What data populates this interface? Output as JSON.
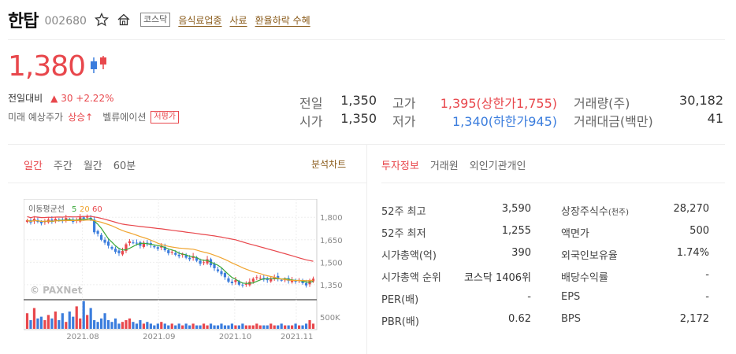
{
  "header": {
    "name": "한탑",
    "code": "002680",
    "market": "코스닥",
    "tags": [
      "음식료업종",
      "사료",
      "환율하락 수혜"
    ]
  },
  "quote": {
    "price": "1,380",
    "change_label": "전일대비",
    "change_text": "▲ 30 +2.22%",
    "expect_label": "미래 예상주가",
    "expect_value": "상승↑",
    "valuation_label": "벨류에이션",
    "valuation_badge": "저평가",
    "prev_label": "전일",
    "prev_value": "1,350",
    "open_label": "시가",
    "open_value": "1,350",
    "high_label": "고가",
    "high_value": "1,395(상한가1,755)",
    "low_label": "저가",
    "low_value": "1,340(하한가945)",
    "volume_label": "거래량(주)",
    "volume_value": "30,182",
    "amount_label": "거래대금(백만)",
    "amount_value": "41"
  },
  "chart_tabs": [
    "일간",
    "주간",
    "월간",
    "60분"
  ],
  "analysis_label": "분석차트",
  "chart_data": {
    "type": "line",
    "legend_label": "이동평균선",
    "ma_labels": [
      "5",
      "20",
      "60"
    ],
    "ma_colors": [
      "#3aa83a",
      "#f0a531",
      "#e8474c"
    ],
    "y_ticks": [
      "1,800",
      "1,650",
      "1,500",
      "1,350"
    ],
    "volume_tick": "500K",
    "x_ticks": [
      "2021.08",
      "2021.09",
      "2021.10",
      "2021.11"
    ],
    "watermark": "© PAXNet",
    "up_color": "#e8474c",
    "down_color": "#3b7ddd",
    "close": [
      1780,
      1765,
      1790,
      1770,
      1760,
      1775,
      1785,
      1770,
      1790,
      1780,
      1775,
      1795,
      1785,
      1770,
      1780,
      1800,
      1790,
      1805,
      1785,
      1700,
      1690,
      1650,
      1630,
      1610,
      1590,
      1570,
      1560,
      1575,
      1620,
      1640,
      1630,
      1625,
      1610,
      1630,
      1620,
      1615,
      1600,
      1590,
      1610,
      1580,
      1560,
      1570,
      1550,
      1540,
      1555,
      1530,
      1520,
      1540,
      1510,
      1490,
      1500,
      1520,
      1480,
      1460,
      1440,
      1420,
      1400,
      1370,
      1360,
      1380,
      1350,
      1345,
      1355,
      1370,
      1390,
      1400,
      1395,
      1385,
      1380,
      1390,
      1400,
      1390,
      1380,
      1385,
      1375,
      1380,
      1370,
      1380,
      1360,
      1345,
      1380,
      1390
    ],
    "volume": [
      0.9,
      0.5,
      1.2,
      0.6,
      0.7,
      0.5,
      0.8,
      0.6,
      1.0,
      0.5,
      0.9,
      0.4,
      1.0,
      0.7,
      1.3,
      0.6,
      1.6,
      0.8,
      1.2,
      0.5,
      0.4,
      0.6,
      0.9,
      0.5,
      0.4,
      0.6,
      0.3,
      0.4,
      0.5,
      0.6,
      0.4,
      0.3,
      0.5,
      0.3,
      0.4,
      0.3,
      0.2,
      0.3,
      0.4,
      0.3,
      0.2,
      0.3,
      0.2,
      0.3,
      0.2,
      0.3,
      0.2,
      0.3,
      0.2,
      0.2,
      0.3,
      0.2,
      0.3,
      0.2,
      0.2,
      0.3,
      0.2,
      0.2,
      0.3,
      0.2,
      0.2,
      0.3,
      0.2,
      0.2,
      0.2,
      0.3,
      0.2,
      0.2,
      0.2,
      0.3,
      0.2,
      0.2,
      0.3,
      0.2,
      0.2,
      0.2,
      0.3,
      0.2,
      0.2,
      0.3,
      0.5,
      0.3
    ]
  },
  "invest_tabs": [
    "투자정보",
    "거래원",
    "외인기관개인"
  ],
  "invest": {
    "left": [
      {
        "label": "52주 최고",
        "value": "3,590"
      },
      {
        "label": "52주 최저",
        "value": "1,255"
      },
      {
        "label": "시가총액(억)",
        "value": "390"
      },
      {
        "label": "시가총액 순위",
        "value": "코스닥 1406위"
      },
      {
        "label": "PER(배)",
        "value": "-"
      },
      {
        "label": "PBR(배)",
        "value": "0.62"
      }
    ],
    "right": [
      {
        "label": "상장주식수",
        "label_small": "(천주)",
        "value": "28,270"
      },
      {
        "label": "액면가",
        "label_small": "",
        "value": "500"
      },
      {
        "label": "외국인보유율",
        "label_small": "",
        "value": "1.74%"
      },
      {
        "label": "배당수익률",
        "label_small": "",
        "value": "-"
      },
      {
        "label": "EPS",
        "label_small": "",
        "value": "-"
      },
      {
        "label": "BPS",
        "label_small": "",
        "value": "2,172"
      }
    ]
  }
}
